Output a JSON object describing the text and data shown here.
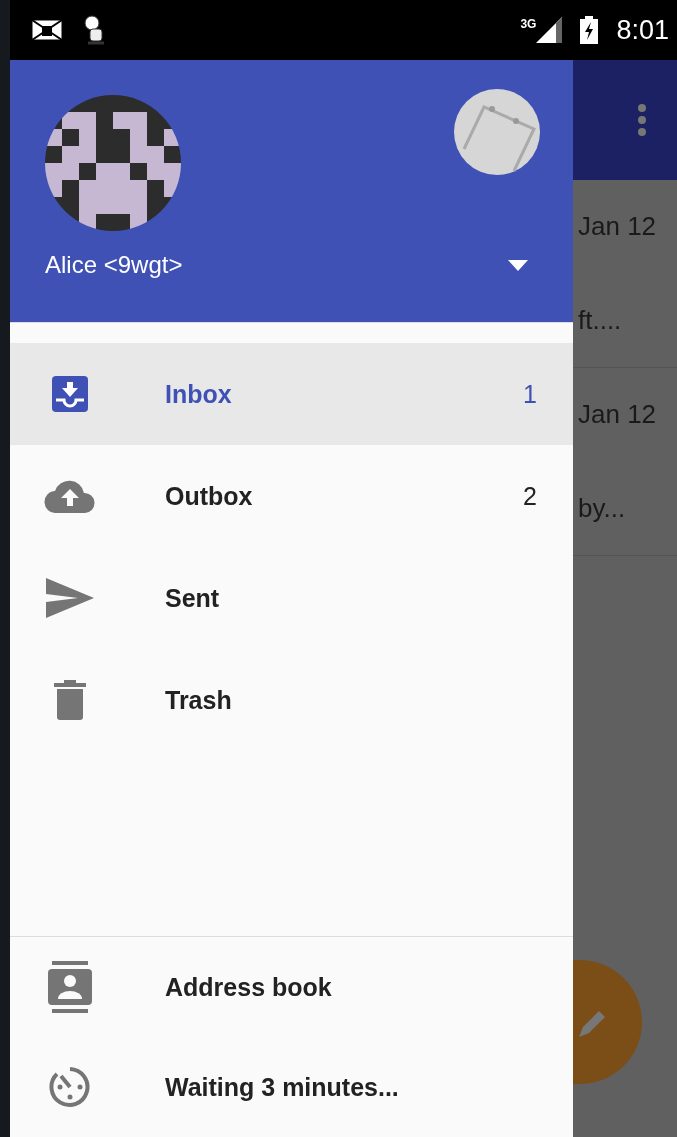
{
  "status_bar": {
    "network": "3G",
    "time": "8:01"
  },
  "background": {
    "messages": [
      {
        "date": "Jan 12",
        "preview": "ft...."
      },
      {
        "date": "Jan 12",
        "preview": "by..."
      }
    ]
  },
  "drawer": {
    "account": {
      "name": "Alice <9wgt>"
    },
    "folders": [
      {
        "kind": "inbox",
        "label": "Inbox",
        "count": "1",
        "selected": true
      },
      {
        "kind": "outbox",
        "label": "Outbox",
        "count": "2",
        "selected": false
      },
      {
        "kind": "sent",
        "label": "Sent",
        "selected": false
      },
      {
        "kind": "trash",
        "label": "Trash",
        "selected": false
      }
    ],
    "footer_items": [
      {
        "kind": "address-book",
        "label": "Address book"
      },
      {
        "kind": "timer",
        "label": "Waiting 3 minutes..."
      }
    ]
  }
}
